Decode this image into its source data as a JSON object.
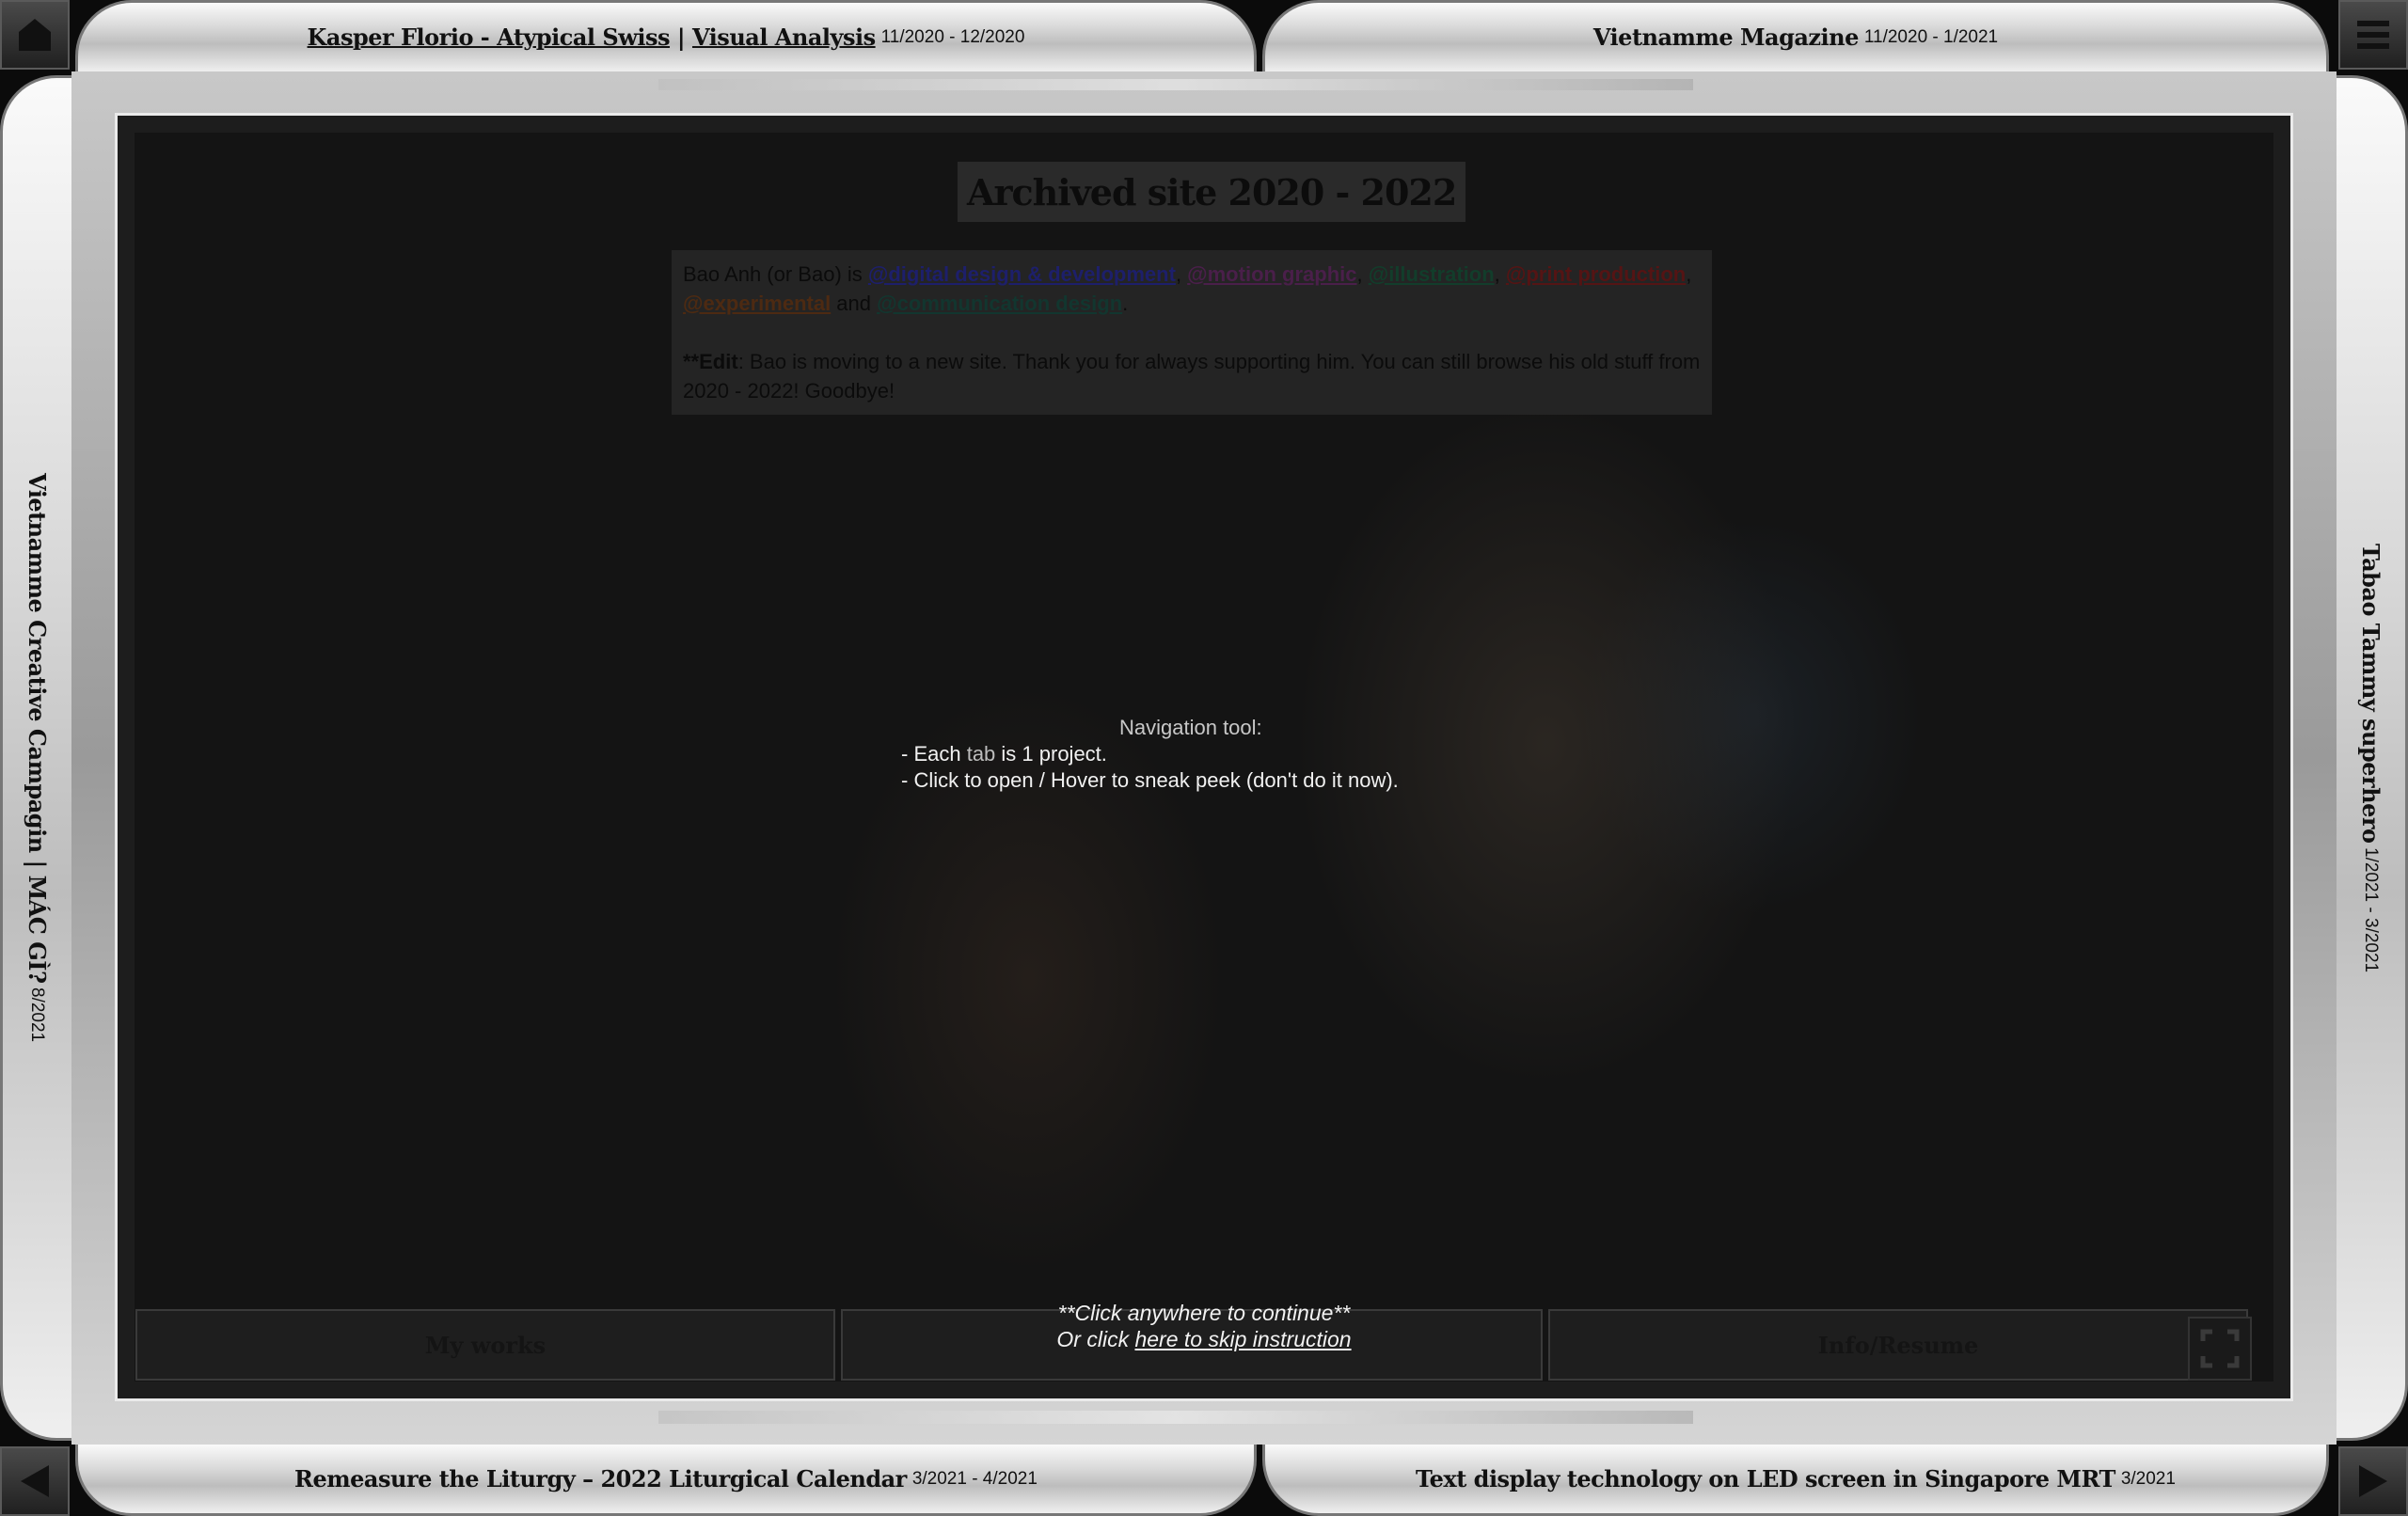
{
  "tabs": {
    "top_left": {
      "part1": "Kasper Florio - Atypical Swiss",
      "separator": " | ",
      "part2": "Visual Analysis",
      "date": "11/2020 - 12/2020"
    },
    "top_right": {
      "title": "Vietnamme Magazine",
      "date": "11/2020 - 1/2021"
    },
    "left": {
      "title": "Vietnamme Creative Campagin | MÁC GÌ?",
      "date": "8/2021"
    },
    "right": {
      "title": "Tabao Tammy superhero",
      "date": "1/2021 - 3/2021"
    },
    "bottom_left": {
      "title": "Remeasure the Liturgy – 2022 Liturgical Calendar",
      "date": "3/2021 - 4/2021"
    },
    "bottom_right": {
      "title": "Text display technology on LED screen in Singapore MRT",
      "date": "3/2021"
    }
  },
  "corners": {
    "top_left_icon": "home-icon",
    "top_right_icon": "menu-icon",
    "bottom_left_icon": "prev-arrow-icon",
    "bottom_right_icon": "next-arrow-icon"
  },
  "main": {
    "title": "Archived site 2020 - 2022",
    "intro": {
      "prefix": "Bao Anh (or Bao) is ",
      "link_digital": "@digital design & development",
      "comma1": ", ",
      "link_motion": "@motion graphic",
      "comma2": ", ",
      "link_illustration": "@illustration",
      "comma3": ", ",
      "link_print": "@print production",
      "comma4": ", ",
      "link_experimental": "@experimental",
      "and": " and ",
      "link_communication": "@communication design",
      "period": ".",
      "edit_label": "**Edit",
      "edit_text": ": Bao is moving to a new site. Thank you for always supporting him. You can still browse his old stuff from 2020 - 2022! Goodbye!"
    },
    "navigation": {
      "heading": "Navigation tool:",
      "line1_prefix": "- Each ",
      "line1_word": "tab",
      "line1_suffix": " is 1 project.",
      "line2": "- Click to open / Hover to sneak peek (don't do it now)."
    },
    "continue": {
      "line1": "**Click anywhere to continue**",
      "line2_prefix": "Or click ",
      "line2_link": "here to skip instruction"
    }
  },
  "bottom_bar": {
    "my_works": "My works",
    "middle": "",
    "info_resume": "Info/Resume",
    "fullscreen_icon": "fullscreen-icon"
  }
}
